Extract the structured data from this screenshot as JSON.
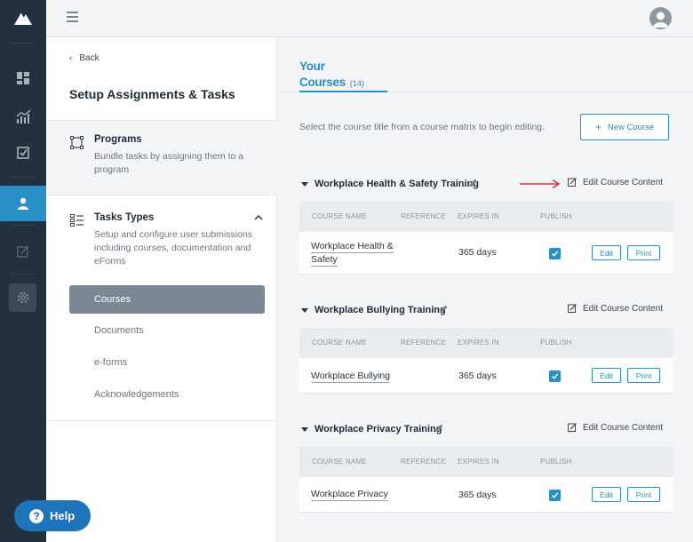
{
  "topbar": {
    "avatar_icon": "user-avatar-icon",
    "menu_icon": "hamburger-icon"
  },
  "rail": {
    "items": [
      {
        "icon": "dashboard-icon"
      },
      {
        "icon": "chart-icon"
      },
      {
        "icon": "checklist-icon"
      },
      {
        "icon": "person-icon",
        "active": true
      },
      {
        "icon": "edit-icon"
      },
      {
        "icon": "settings-icon"
      }
    ]
  },
  "panel": {
    "back_label": "Back",
    "title": "Setup Assignments & Tasks",
    "programs": {
      "title": "Programs",
      "description": "Bundle tasks by assigning them to a program"
    },
    "task_types": {
      "title": "Tasks Types",
      "description": "Setup and configure user submissions including courses, documentation and eForms"
    },
    "sub_items": [
      {
        "label": "Courses",
        "active": true
      },
      {
        "label": "Documents"
      },
      {
        "label": "e-forms"
      },
      {
        "label": "Acknowledgements"
      }
    ]
  },
  "help": {
    "label": "Help"
  },
  "main": {
    "tab": {
      "label": "Your Courses",
      "count": "(14)"
    },
    "hint": "Select the course title from a course matrix to begin editing.",
    "new_course_label": "New Course",
    "edit_content_label": "Edit Course Content",
    "columns": [
      "COURSE NAME",
      "REFERENCE",
      "EXPIRES IN",
      "PUBLISH"
    ],
    "edit_label": "Edit",
    "print_label": "Print",
    "sections": [
      {
        "title": "Workplace Health & Safety Training",
        "course_name_l1": "Workplace Health &",
        "course_name_l2": "Safety",
        "reference": "",
        "expires": "365 days",
        "published": true
      },
      {
        "title": "Workplace Bullying Training",
        "course_name_l1": "Workplace Bullying",
        "course_name_l2": "",
        "reference": "",
        "expires": "365 days",
        "published": true
      },
      {
        "title": "Workplace Privacy Training",
        "course_name_l1": "Workplace Privacy",
        "course_name_l2": "",
        "reference": "",
        "expires": "365 days",
        "published": true
      }
    ]
  },
  "colors": {
    "accent": "#2a8fc4",
    "rail_bg": "#23303d",
    "help_bg": "#1e73ba",
    "active_sub": "#7a8794",
    "arrow": "#d9343b"
  }
}
